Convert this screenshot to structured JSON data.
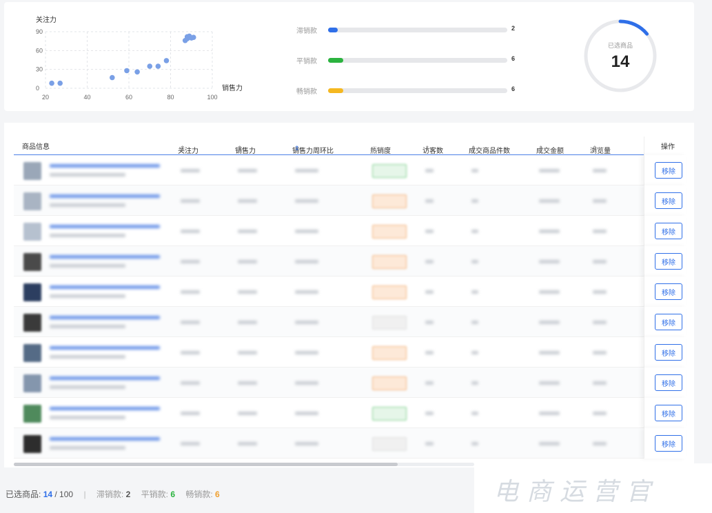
{
  "chart_data": {
    "type": "scatter",
    "ylabel": "关注力",
    "xlabel": "销售力",
    "x_ticks": [
      "20",
      "40",
      "60",
      "80",
      "100"
    ],
    "y_ticks": [
      "90",
      "60",
      "30",
      "0"
    ],
    "xlim": [
      20,
      100
    ],
    "ylim": [
      0,
      90
    ],
    "points": [
      {
        "x": 23,
        "y": 8
      },
      {
        "x": 27,
        "y": 8
      },
      {
        "x": 52,
        "y": 17
      },
      {
        "x": 59,
        "y": 28
      },
      {
        "x": 64,
        "y": 26
      },
      {
        "x": 70,
        "y": 35
      },
      {
        "x": 74,
        "y": 35
      },
      {
        "x": 78,
        "y": 44
      },
      {
        "x": 87,
        "y": 76
      },
      {
        "x": 88,
        "y": 79
      },
      {
        "x": 88,
        "y": 82
      },
      {
        "x": 89,
        "y": 83
      },
      {
        "x": 90,
        "y": 80
      },
      {
        "x": 91,
        "y": 81
      }
    ],
    "point_color": "#7aa0e6",
    "grid": true
  },
  "bars": [
    {
      "label": "滞销款",
      "value": "2",
      "color": "#2f6fe8",
      "fraction": 0.055
    },
    {
      "label": "平销款",
      "value": "6",
      "color": "#2bb33f",
      "fraction": 0.085
    },
    {
      "label": "畅销款",
      "value": "6",
      "color": "#f5b820",
      "fraction": 0.085
    }
  ],
  "ring": {
    "label": "已选商品",
    "value": "14",
    "fraction": 0.14,
    "color": "#2f6fe8"
  },
  "table": {
    "headers": {
      "product": "商品信息",
      "attention": "关注力",
      "sales": "销售力",
      "wow": "销售力周环比",
      "hot": "热销度",
      "visitors": "访客数",
      "units": "成交商品件数",
      "amount": "成交金额",
      "views": "浏览量",
      "action": "操作"
    },
    "remove_label": "移除",
    "rows": [
      {
        "thumb": "#9aa7b8",
        "pill": "#e6f6e9",
        "pillb": "#7fd18e"
      },
      {
        "thumb": "#a9b4c3",
        "pill": "#fde9d8",
        "pillb": "#f3b27a"
      },
      {
        "thumb": "#b6c1cf",
        "pill": "#fde9d8",
        "pillb": "#f3b27a"
      },
      {
        "thumb": "#4a4a4a",
        "pill": "#fde9d8",
        "pillb": "#f3b27a"
      },
      {
        "thumb": "#2c3e60",
        "pill": "#fde9d8",
        "pillb": "#f3b27a"
      },
      {
        "thumb": "#3a3a3a",
        "pill": "#f0f0f0",
        "pillb": "#dddddd"
      },
      {
        "thumb": "#556b86",
        "pill": "#fde9d8",
        "pillb": "#f3b27a"
      },
      {
        "thumb": "#8496ad",
        "pill": "#fde9d8",
        "pillb": "#f3b27a"
      },
      {
        "thumb": "#4f8a5c",
        "pill": "#e6f6e9",
        "pillb": "#7fd18e"
      },
      {
        "thumb": "#2d2d2d",
        "pill": "#f0f0f0",
        "pillb": "#dddddd"
      }
    ]
  },
  "footer": {
    "selected_label": "已选商品:",
    "selected": "14",
    "total": "/ 100",
    "sep": "|",
    "slow_label": "滞销款:",
    "slow": "2",
    "normal_label": "平销款:",
    "normal": "6",
    "hot_label": "畅销款:",
    "hot": "6"
  },
  "watermark": "电商运营官"
}
